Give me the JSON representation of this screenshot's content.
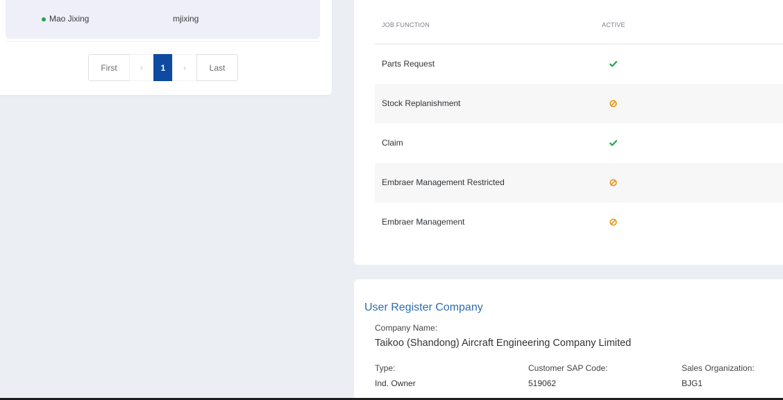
{
  "users": {
    "row": {
      "name": "Mao Jixing",
      "login": "mjixing",
      "status_color": "#2ba24c"
    }
  },
  "pagination": {
    "first": "First",
    "prev": "‹",
    "current": "1",
    "next": "›",
    "last": "Last"
  },
  "job_functions": {
    "headers": {
      "function": "JOB FUNCTION",
      "active": "ACTIVE"
    },
    "rows": [
      {
        "name": "Parts Request",
        "active": true,
        "icon": "check-icon"
      },
      {
        "name": "Stock Replanishment",
        "active": false,
        "icon": "ban-icon"
      },
      {
        "name": "Claim",
        "active": true,
        "icon": "check-icon"
      },
      {
        "name": "Embraer Management Restricted",
        "active": false,
        "icon": "ban-icon"
      },
      {
        "name": "Embraer Management",
        "active": false,
        "icon": "ban-icon"
      }
    ]
  },
  "company": {
    "title": "User Register Company",
    "name_label": "Company Name:",
    "name_value": "Taikoo (Shandong) Aircraft Engineering Company Limited",
    "type_label": "Type:",
    "type_value": "Ind. Owner",
    "sap_label": "Customer SAP Code:",
    "sap_value": "519062",
    "sales_label": "Sales Organization:",
    "sales_value": "BJG1"
  },
  "colors": {
    "accent": "#0e4aa0",
    "active_green": "#2ba24c",
    "inactive_orange": "#e8900c",
    "title_blue": "#2a6db3"
  }
}
